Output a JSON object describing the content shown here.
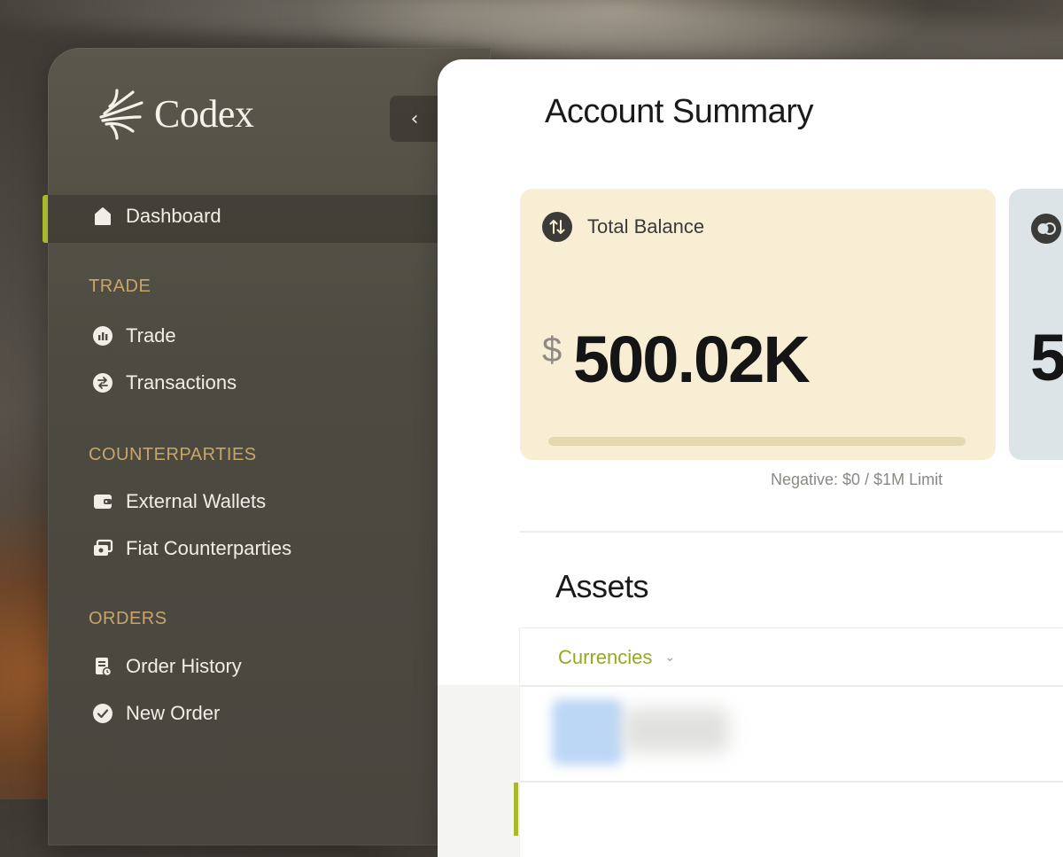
{
  "app": {
    "name": "Codex"
  },
  "sidebar": {
    "collapse_icon": "chevron-left-icon",
    "dashboard": {
      "label": "Dashboard",
      "icon": "home-icon",
      "active": true
    },
    "sections": [
      {
        "title": "TRADE",
        "items": [
          {
            "label": "Trade",
            "icon": "chart-icon"
          },
          {
            "label": "Transactions",
            "icon": "swap-icon"
          }
        ]
      },
      {
        "title": "COUNTERPARTIES",
        "items": [
          {
            "label": "External Wallets",
            "icon": "wallet-icon"
          },
          {
            "label": "Fiat Counterparties",
            "icon": "cash-icon"
          }
        ]
      },
      {
        "title": "ORDERS",
        "items": [
          {
            "label": "Order History",
            "icon": "receipt-icon"
          },
          {
            "label": "New Order",
            "icon": "check-circle-icon"
          }
        ]
      }
    ]
  },
  "main": {
    "title": "Account Summary",
    "balance_card": {
      "label": "Total Balance",
      "icon": "swap-vertical-icon",
      "currency": "$",
      "value": "500.02K",
      "limit_text": "Negative: $0 / $1M Limit",
      "limit_progress": 0
    },
    "second_card": {
      "value_partial": "5",
      "icon": "toggle-icon"
    },
    "assets": {
      "title": "Assets",
      "filter_label": "Currencies",
      "filter_icon": "chevron-down-icon"
    }
  },
  "colors": {
    "accent": "#a7b82a",
    "section_label": "#c8a66a",
    "balance_card_bg": "#f8eed4",
    "second_card_bg": "#dde4e8"
  }
}
